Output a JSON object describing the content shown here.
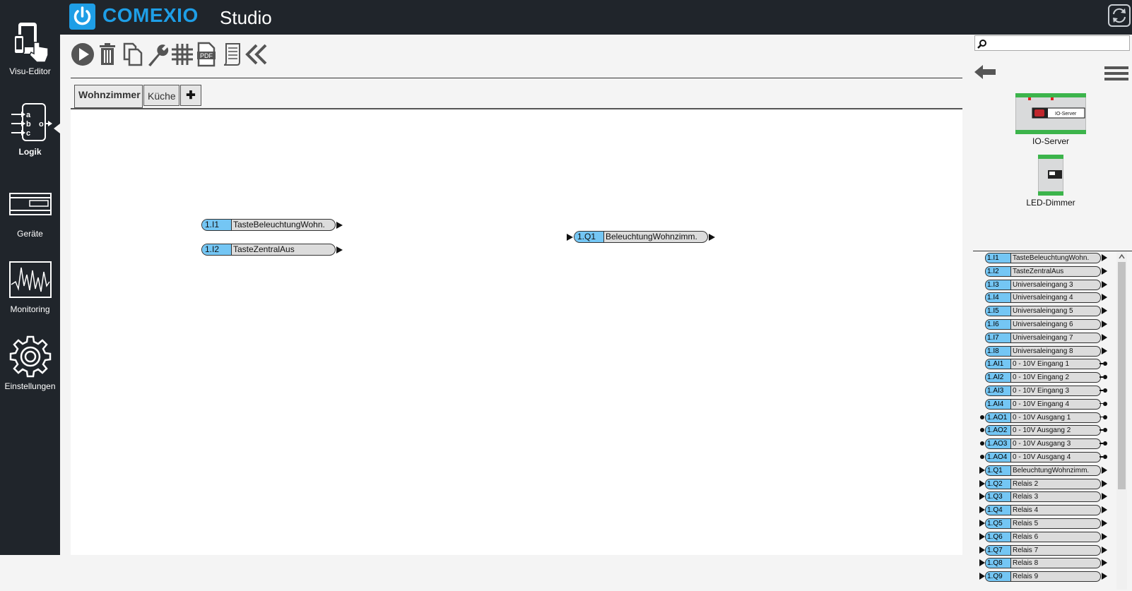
{
  "app": {
    "brand": "COMEXIO",
    "product": "Studio"
  },
  "sidebar": {
    "items": [
      {
        "label": "Visu-Editor",
        "icon": "tablet-touch-icon"
      },
      {
        "label": "Logik",
        "icon": "logic-block-icon",
        "active": true
      },
      {
        "label": "Geräte",
        "icon": "device-rack-icon"
      },
      {
        "label": "Monitoring",
        "icon": "monitoring-chart-icon"
      },
      {
        "label": "Einstellungen",
        "icon": "gear-icon"
      }
    ],
    "logic_icon_letters": {
      "a": "a",
      "b": "b",
      "c": "c",
      "o": "o"
    }
  },
  "toolbar": {
    "tools": [
      "play-icon",
      "trash-icon",
      "copy-icon",
      "wrench-icon",
      "grid-icon",
      "pdf-icon",
      "scroll-icon",
      "collapse-icon"
    ],
    "pdf_label": "PDF"
  },
  "tabs": {
    "items": [
      "Wohnzimmer",
      "Küche"
    ],
    "add_label": "✚"
  },
  "canvas": {
    "nodes": [
      {
        "id": "1.I1",
        "name": "TasteBeleuchtungWohn."
      },
      {
        "id": "1.I2",
        "name": "TasteZentralAus"
      },
      {
        "id": "1.Q1",
        "name": "BeleuchtungWohnzimm."
      }
    ]
  },
  "right_panel": {
    "search_value": "",
    "devices": [
      {
        "name": "IO-Server",
        "badge": "IO-Server"
      },
      {
        "name": "LED-Dimmer"
      }
    ],
    "io_list": [
      {
        "id": "1.I1",
        "name": "TasteBeleuchtungWohn.",
        "type": "input"
      },
      {
        "id": "1.I2",
        "name": "TasteZentralAus",
        "type": "input"
      },
      {
        "id": "1.I3",
        "name": "Universaleingang 3",
        "type": "input"
      },
      {
        "id": "1.I4",
        "name": "Universaleingang 4",
        "type": "input"
      },
      {
        "id": "1.I5",
        "name": "Universaleingang 5",
        "type": "input"
      },
      {
        "id": "1.I6",
        "name": "Universaleingang 6",
        "type": "input"
      },
      {
        "id": "1.I7",
        "name": "Universaleingang 7",
        "type": "input"
      },
      {
        "id": "1.I8",
        "name": "Universaleingang 8",
        "type": "input"
      },
      {
        "id": "1.AI1",
        "name": "0 - 10V Eingang 1",
        "type": "analog-in"
      },
      {
        "id": "1.AI2",
        "name": "0 - 10V Eingang 2",
        "type": "analog-in"
      },
      {
        "id": "1.AI3",
        "name": "0 - 10V Eingang 3",
        "type": "analog-in"
      },
      {
        "id": "1.AI4",
        "name": "0 - 10V Eingang 4",
        "type": "analog-in"
      },
      {
        "id": "1.AO1",
        "name": "0 - 10V Ausgang 1",
        "type": "analog-out"
      },
      {
        "id": "1.AO2",
        "name": "0 - 10V Ausgang 2",
        "type": "analog-out"
      },
      {
        "id": "1.AO3",
        "name": "0 - 10V Ausgang 3",
        "type": "analog-out"
      },
      {
        "id": "1.AO4",
        "name": "0 - 10V Ausgang 4",
        "type": "analog-out"
      },
      {
        "id": "1.Q1",
        "name": "BeleuchtungWohnzimm.",
        "type": "output"
      },
      {
        "id": "1.Q2",
        "name": "Relais 2",
        "type": "output"
      },
      {
        "id": "1.Q3",
        "name": "Relais 3",
        "type": "output"
      },
      {
        "id": "1.Q4",
        "name": "Relais 4",
        "type": "output"
      },
      {
        "id": "1.Q5",
        "name": "Relais 5",
        "type": "output"
      },
      {
        "id": "1.Q6",
        "name": "Relais 6",
        "type": "output"
      },
      {
        "id": "1.Q7",
        "name": "Relais 7",
        "type": "output"
      },
      {
        "id": "1.Q8",
        "name": "Relais 8",
        "type": "output"
      },
      {
        "id": "1.Q9",
        "name": "Relais 9",
        "type": "output"
      }
    ]
  },
  "colors": {
    "dark_bg": "#20252b",
    "brand_blue": "#1e9ee6",
    "io_id_blue": "#74c6f4",
    "pill_grey": "#dcdcdc"
  }
}
